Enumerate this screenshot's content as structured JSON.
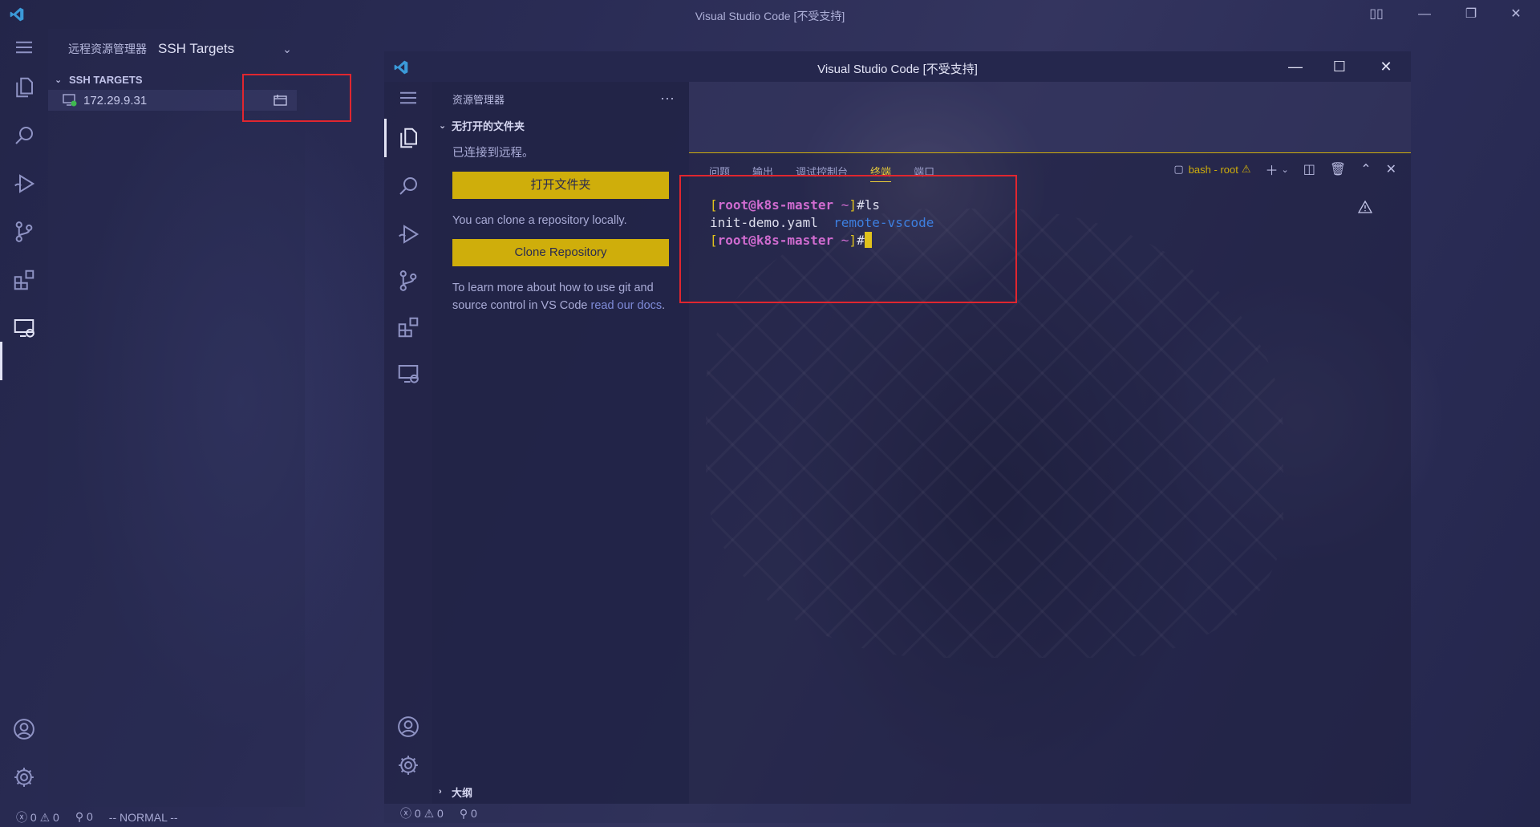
{
  "outer": {
    "title": "Visual Studio Code [不受支持]",
    "sidebar": {
      "header": "远程资源管理器",
      "view_select": "SSH Targets",
      "section": "SSH TARGETS",
      "host": "172.29.9.31"
    },
    "status": {
      "errors": "0",
      "warnings": "0",
      "ports": "0",
      "mode": "-- NORMAL --"
    }
  },
  "inner": {
    "title": "Visual Studio Code [不受支持]",
    "explorer": {
      "header": "资源管理器",
      "more": "···",
      "section": "无打开的文件夹",
      "connected": "已连接到远程。",
      "open_folder_button": "打开文件夹",
      "clone_text": "You can clone a repository locally.",
      "clone_button": "Clone Repository",
      "learn_text": "To learn more about how to use git and source control in VS Code ",
      "learn_link": "read our docs",
      "learn_end": ".",
      "outline": "大纲"
    },
    "panel": {
      "tabs": [
        "问题",
        "输出",
        "调试控制台",
        "终端",
        "端口"
      ],
      "active_tab": "终端",
      "terminal_name": "bash - root"
    },
    "terminal": {
      "user": "root",
      "at": "@",
      "host": "k8s-master",
      "tilde": "~",
      "hash": "#",
      "cmd1": "ls",
      "file1": "init-demo.yaml",
      "dir1": "remote-vscode"
    },
    "status": {
      "errors": "0",
      "warnings": "0",
      "ports": "0"
    }
  },
  "colors": {
    "accent": "#cfae0b",
    "highlight_box": "#e0262f",
    "prompt_bracket": "#e0c21c",
    "prompt_user": "#cf6bcf",
    "dir": "#3d7fe0"
  },
  "icons": [
    "vscode-logo-icon",
    "menu-icon",
    "explorer-icon",
    "search-icon",
    "run-debug-icon",
    "source-control-icon",
    "extensions-icon",
    "remote-explorer-icon",
    "account-icon",
    "settings-gear-icon",
    "connect-new-window-icon",
    "warning-icon"
  ]
}
